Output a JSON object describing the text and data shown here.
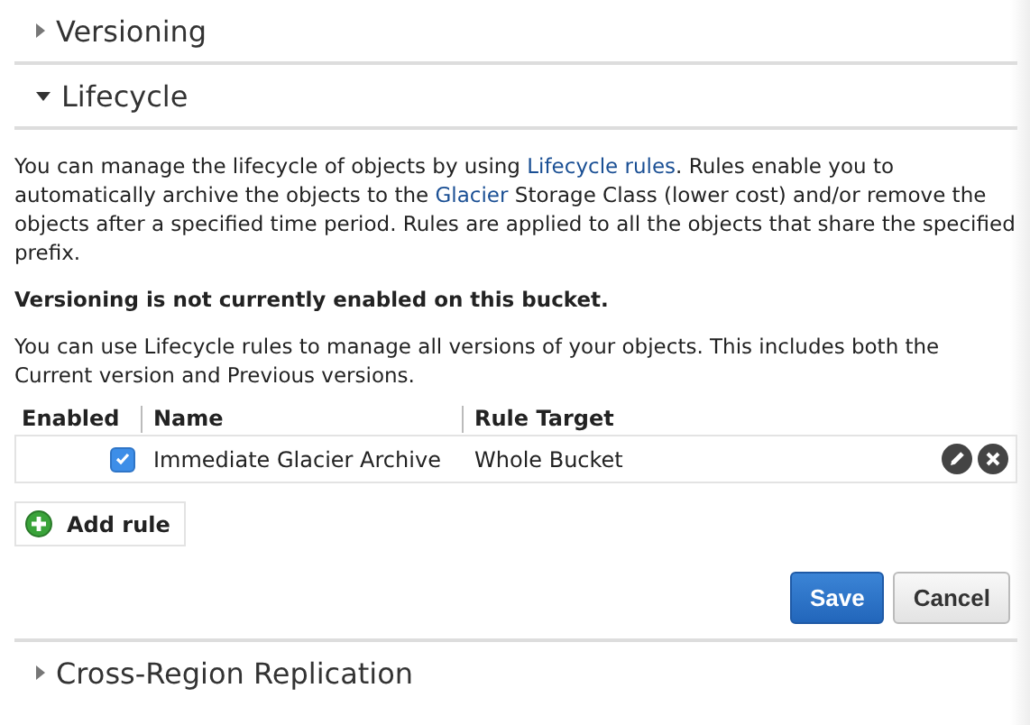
{
  "sections": [
    {
      "title": "Versioning",
      "expanded": false
    },
    {
      "title": "Lifecycle",
      "expanded": true,
      "intro": [
        {
          "text": "You can manage the lifecycle of objects by using ",
          "link": false
        },
        {
          "text": "Lifecycle rules",
          "link": true
        },
        {
          "text": ". Rules enable you to automatically archive the objects to the ",
          "link": false
        },
        {
          "text": "Glacier",
          "link": true
        },
        {
          "text": " Storage Class (lower cost) and/or remove the objects after a specified time period. Rules are applied to all the objects that share the specified prefix.",
          "link": false
        }
      ],
      "notice": "Versioning is not currently enabled on this bucket.",
      "note": "You can use Lifecycle rules to manage all versions of your objects. This includes both the Current version and Previous versions.",
      "table": {
        "columns": [
          "Enabled",
          "Name",
          "Rule Target"
        ],
        "rows": [
          {
            "enabled": true,
            "name": "Immediate Glacier Archive",
            "target": "Whole Bucket"
          }
        ]
      },
      "add_button": "Add rule",
      "buttons": [
        {
          "label": "Save",
          "kind": "primary"
        },
        {
          "label": "Cancel",
          "kind": "secondary"
        }
      ]
    },
    {
      "title": "Cross-Region Replication",
      "expanded": false
    }
  ]
}
